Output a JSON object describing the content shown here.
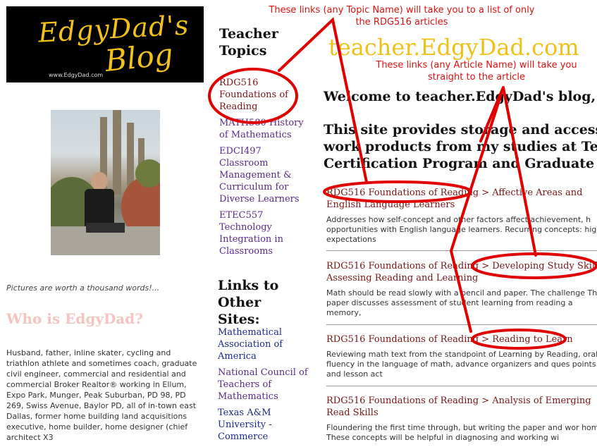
{
  "logo": {
    "line1": "EdgyDad's",
    "line2": "Blog",
    "url": "www.EdgyDad.com"
  },
  "photo_caption": "Pictures are worth a thousand words!...",
  "who_heading": "Who is EdgyDad?",
  "bio": "Husband, father, inline skater, cycling and triathlon athlete and sometimes coach, graduate civil engineer, commercial and residential and commercial Broker Realtor® working in Ellum, Expo Park, Munger, Peak Suburban, PD 98, PD 269, Swiss Avenue, Baylor PD, all of in-town east Dallas, former home building land acquisitions executive, home builder, home designer (chief architect X3",
  "topics": {
    "heading": "Teacher Topics",
    "items": [
      {
        "label": "RDG516 Foundations of Reading"
      },
      {
        "label": "MATH580 History of Mathematics"
      },
      {
        "label": "EDCI497 Classroom Management & Curriculum for Diverse Learners"
      },
      {
        "label": "ETEC557 Technology Integration in Classrooms"
      }
    ]
  },
  "links": {
    "heading": "Links to Other Sites:",
    "items": [
      {
        "label": "Mathematical Association of America"
      },
      {
        "label": "National Council of Teachers of Mathematics"
      },
      {
        "label": "Texas A&M University - Commerce"
      }
    ]
  },
  "main": {
    "site_title": "teacher.EdgyDad.com",
    "welcome": "Welcome to teacher.EdgyDad's blog, h",
    "intro_lines": [
      "This site provides storage and access to",
      "work products from my studies at Texa",
      "Certification Program and Graduate M"
    ]
  },
  "posts": [
    {
      "topic": "RDG516 Foundations of Reading",
      "sep": " > ",
      "article": "Affective Areas and English Language Learners",
      "desc": "Addresses how self-concept and other factors affect achievement, h opportunities with English language learners. Recurring concepts: high expectations"
    },
    {
      "topic": "RDG516 Foundations of Reading",
      "sep": " > ",
      "article": "Developing Study Skills, Assessing Reading and Learning",
      "desc": "Math should be read slowly with a pencil and paper. The challenge This paper discusses assessment of student learning from reading a memory,"
    },
    {
      "topic": "RDG516 Foundations of Reading",
      "sep": " > ",
      "article": "Reading to Learn",
      "desc": "Reviewing math text from the standpoint of Learning by Reading, oral fluency in the language of math, advance organizers and ques points and lesson act"
    },
    {
      "topic": "RDG516 Foundations of Reading",
      "sep": " > ",
      "article": "Analysis of Emerging Read Skills",
      "desc": "Floundering the first time through, but writing the paper and wor home. These concepts will be helpful in diagnosing and working wi"
    }
  ],
  "annotations": {
    "topic_note_1": "These links (any Topic Name) will take you to a list of only",
    "topic_note_2": "the RDG516 articles",
    "article_note_1": "These links (any Article Name) will take you",
    "article_note_2": "straight to the article"
  },
  "colors": {
    "annotation": "#dd1111",
    "site_title": "#f0c018",
    "post_link": "#7b1515",
    "other_link": "#1b2a8f",
    "logo_bg": "#000000"
  }
}
